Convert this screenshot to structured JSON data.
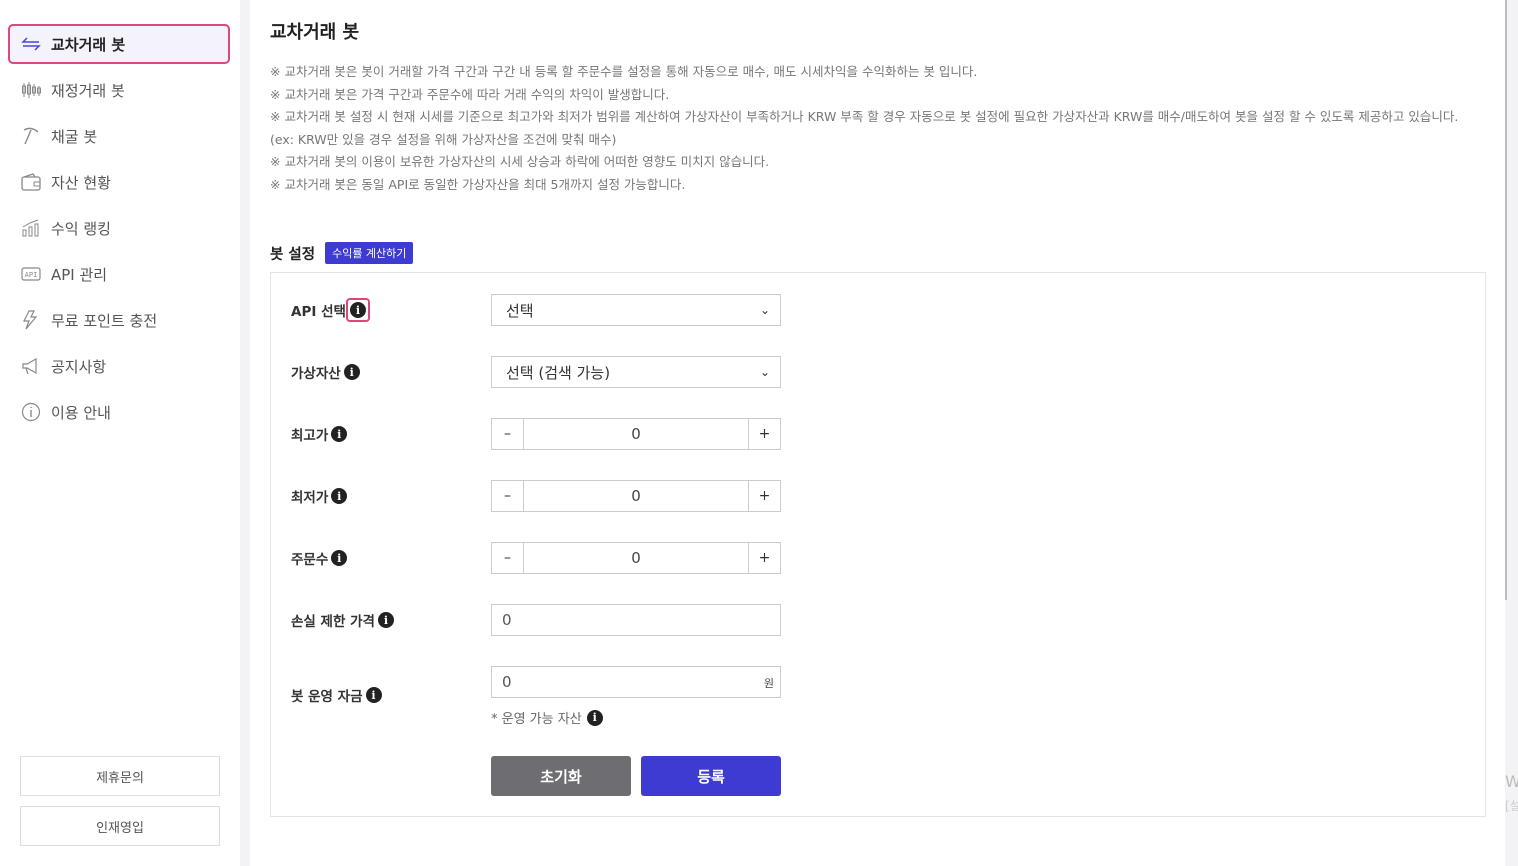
{
  "sidebar": {
    "items": [
      {
        "label": "교차거래 봇",
        "icon": "exchange-arrows-icon"
      },
      {
        "label": "재정거래 봇",
        "icon": "candlestick-icon"
      },
      {
        "label": "채굴 봇",
        "icon": "pickaxe-icon"
      },
      {
        "label": "자산 현황",
        "icon": "wallet-icon"
      },
      {
        "label": "수익 랭킹",
        "icon": "bar-chart-icon"
      },
      {
        "label": "API 관리",
        "icon": "api-icon"
      },
      {
        "label": "무료 포인트 충전",
        "icon": "lightning-icon"
      },
      {
        "label": "공지사항",
        "icon": "megaphone-icon"
      },
      {
        "label": "이용 안내",
        "icon": "info-circle-icon"
      }
    ],
    "partnership": "제휴문의",
    "recruit": "인재영입"
  },
  "main": {
    "title": "교차거래 봇",
    "notes": [
      "※ 교차거래 봇은 봇이 거래할 가격 구간과 구간 내 등록 할 주문수를 설정을 통해 자동으로 매수, 매도 시세차익을 수익화하는 봇 입니다.",
      "※ 교차거래 봇은 가격 구간과 주문수에 따라 거래 수익의 차익이 발생합니다.",
      "※ 교차거래 봇 설정 시 현재 시세를 기준으로 최고가와 최저가 범위를 계산하여 가상자산이 부족하거나 KRW 부족 할 경우 자동으로 봇 설정에 필요한 가상자산과 KRW를 매수/매도하여 봇을 설정 할 수 있도록 제공하고 있습니다. (ex: KRW만 있을 경우 설정을 위해 가상자산을 조건에 맞춰 매수)",
      "※ 교차거래 봇의 이용이 보유한 가상자산의 시세 상승과 하락에 어떠한 영향도 미치지 않습니다.",
      "※ 교차거래 봇은 동일 API로 동일한 가상자산을 최대 5개까지 설정 가능합니다."
    ]
  },
  "bot_settings": {
    "title": "봇 설정",
    "calc_button": "수익률 계산하기",
    "api_label": "API 선택",
    "api_value": "선택",
    "asset_label": "가상자산",
    "asset_value": "선택 (검색 가능)",
    "high_label": "최고가",
    "high_value": "0",
    "low_label": "최저가",
    "low_value": "0",
    "orders_label": "주문수",
    "orders_value": "0",
    "stoploss_label": "손실 제한 가격",
    "stoploss_value": "0",
    "funds_label": "봇 운영 자금",
    "funds_value": "0",
    "funds_unit": "원",
    "available_hint": "* 운영 가능 자산",
    "minus": "–",
    "plus": "+",
    "reset_button": "초기화",
    "submit_button": "등록"
  },
  "watermark": {
    "line1": "W",
    "line2": "[설"
  }
}
